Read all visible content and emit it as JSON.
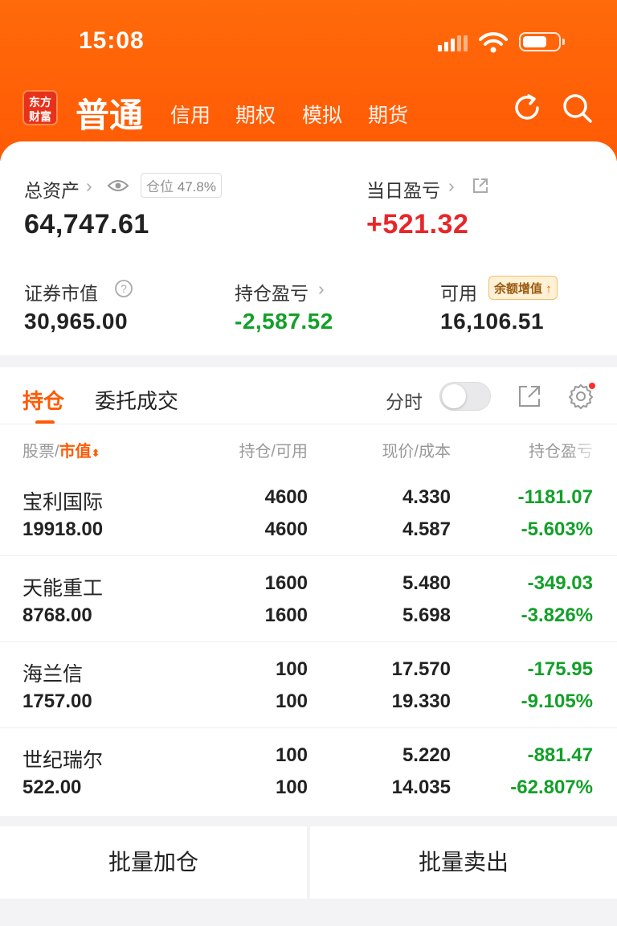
{
  "status_bar": {
    "time": "15:08",
    "battery_level": 0.7
  },
  "nav": {
    "logo_line1": "东方",
    "logo_line2": "财富",
    "active_tab": "普通",
    "tabs": [
      "信用",
      "期权",
      "模拟",
      "期货"
    ]
  },
  "summary": {
    "total_assets_label": "总资产",
    "position_ratio_label": "仓位",
    "position_ratio_value": "47.8%",
    "total_assets": "64,747.61",
    "daily_pnl_label": "当日盈亏",
    "daily_pnl": "+521.32",
    "market_value_label": "证券市值",
    "market_value": "30,965.00",
    "holding_pnl_label": "持仓盈亏",
    "holding_pnl": "-2,587.52",
    "available_label": "可用",
    "available": "16,106.51",
    "promo_label": "余额增值"
  },
  "positions_panel": {
    "tab_active": "持仓",
    "tab_other": "委托成交",
    "timeshare_label": "分时",
    "timeshare_on": false,
    "headers": {
      "stock": "股票",
      "slash1": "/",
      "market_value": "市值",
      "position": "持仓/可用",
      "price": "现价/成本",
      "pnl": "持仓盈亏"
    },
    "rows": [
      {
        "name": "宝利国际",
        "value": "19918.00",
        "qty": "4600",
        "avail": "4600",
        "price": "4.330",
        "cost": "4.587",
        "pnl": "-1181.07",
        "pnl_pct": "-5.603%"
      },
      {
        "name": "天能重工",
        "value": "8768.00",
        "qty": "1600",
        "avail": "1600",
        "price": "5.480",
        "cost": "5.698",
        "pnl": "-349.03",
        "pnl_pct": "-3.826%"
      },
      {
        "name": "海兰信",
        "value": "1757.00",
        "qty": "100",
        "avail": "100",
        "price": "17.570",
        "cost": "19.330",
        "pnl": "-175.95",
        "pnl_pct": "-9.105%"
      },
      {
        "name": "世纪瑞尔",
        "value": "522.00",
        "qty": "100",
        "avail": "100",
        "price": "5.220",
        "cost": "14.035",
        "pnl": "-881.47",
        "pnl_pct": "-62.807%"
      }
    ]
  },
  "actions": {
    "batch_buy": "批量加仓",
    "batch_sell": "批量卖出"
  },
  "colors": {
    "brand": "#ff5a05",
    "up": "#e8262a",
    "down": "#12a028"
  }
}
